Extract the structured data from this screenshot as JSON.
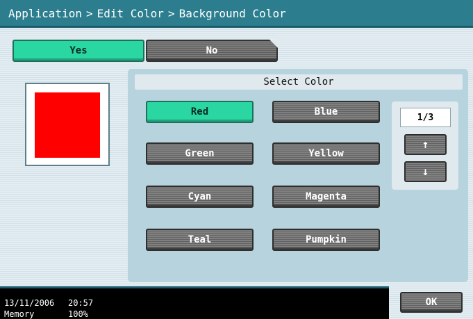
{
  "header": {
    "crumbs": [
      "Application",
      "Edit Color",
      "Background Color"
    ],
    "separator": ">"
  },
  "toggle": {
    "yes_label": "Yes",
    "no_label": "No",
    "selected": "Yes"
  },
  "preview": {
    "color": "#ff0000"
  },
  "select_color": {
    "title": "Select Color",
    "options": [
      {
        "label": "Red",
        "selected": true
      },
      {
        "label": "Blue",
        "selected": false
      },
      {
        "label": "Green",
        "selected": false
      },
      {
        "label": "Yellow",
        "selected": false
      },
      {
        "label": "Cyan",
        "selected": false
      },
      {
        "label": "Magenta",
        "selected": false
      },
      {
        "label": "Teal",
        "selected": false
      },
      {
        "label": "Pumpkin",
        "selected": false
      }
    ],
    "page_indicator": "1/3",
    "up_arrow": "↑",
    "down_arrow": "↓"
  },
  "status": {
    "date": "13/11/2006",
    "time": "20:57",
    "memory_label": "Memory",
    "memory_value": "100%"
  },
  "footer": {
    "ok_label": "OK"
  },
  "colors": {
    "title_bar": "#2c7e8f",
    "selected_button": "#2ad7a2",
    "button_gray": "#707070",
    "panel": "#b6d3de"
  }
}
